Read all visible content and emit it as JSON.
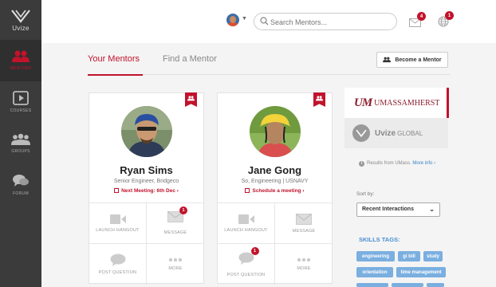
{
  "brand": {
    "name": "Uvize",
    "accent": "#c1132c",
    "sidebar_bg": "#3b3b3b"
  },
  "sidebar": {
    "items": [
      {
        "label": "MENTORS",
        "icon": "mentors-icon",
        "active": true
      },
      {
        "label": "COURSES",
        "icon": "play-icon",
        "active": false
      },
      {
        "label": "GROUPS",
        "icon": "groups-icon",
        "active": false
      },
      {
        "label": "FORUM",
        "icon": "forum-icon",
        "active": false
      }
    ]
  },
  "header": {
    "search_placeholder": "Search Mentors...",
    "messages_count": "4",
    "notifications_count": "1"
  },
  "tabs": [
    {
      "label": "Your Mentors",
      "active": true
    },
    {
      "label": "Find a Mentor",
      "active": false
    }
  ],
  "become_mentor_label": "Become a Mentor",
  "mentors": [
    {
      "name": "Ryan Sims",
      "title": "Senior Engineer, Bridgeco",
      "meeting": "Next Meeting: 6th Dec ›",
      "actions": [
        {
          "label": "LAUNCH HANGOUT",
          "icon": "video-icon",
          "badge": ""
        },
        {
          "label": "MESSAGE",
          "icon": "envelope-icon",
          "badge": "1"
        },
        {
          "label": "POST QUESTION",
          "icon": "chat-bubble-icon",
          "badge": ""
        },
        {
          "label": "MORE",
          "icon": "ellipsis-icon",
          "badge": ""
        }
      ]
    },
    {
      "name": "Jane Gong",
      "title": "So, Engineering | USNAVY",
      "meeting": "Schedule a meeting ›",
      "actions": [
        {
          "label": "LAUNCH HANGOUT",
          "icon": "video-icon",
          "badge": ""
        },
        {
          "label": "MESSAGE",
          "icon": "envelope-icon",
          "badge": ""
        },
        {
          "label": "POST QUESTION",
          "icon": "chat-bubble-icon",
          "badge": "1"
        },
        {
          "label": "MORE",
          "icon": "ellipsis-icon",
          "badge": ""
        }
      ]
    }
  ],
  "orgs": [
    {
      "mark": "UM",
      "name": "UMASSAMHERST"
    },
    {
      "name": "Uvize",
      "suffix": "GLOBAL"
    }
  ],
  "results": {
    "text": "Results from UMass.",
    "link": "More info ›"
  },
  "sort": {
    "label": "Sort by:",
    "selected": "Recent Interactions"
  },
  "skills": {
    "label": "SKILLS TAGS:",
    "tags": [
      "engineering",
      "gi bill",
      "study",
      "orientation",
      "time management"
    ]
  }
}
